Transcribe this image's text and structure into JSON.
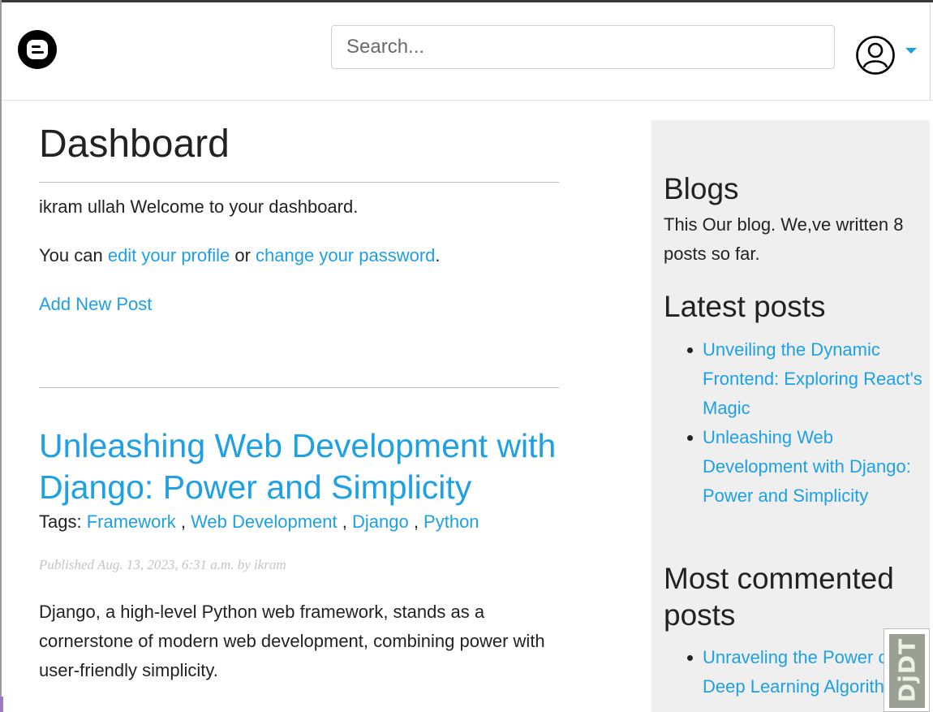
{
  "header": {
    "search_placeholder": "Search...",
    "accent_color": "#1ea0e4"
  },
  "main": {
    "title": "Dashboard",
    "welcome": "ikram ullah Welcome to your dashboard.",
    "profile_prefix": "You can ",
    "edit_profile_link": "edit your profile",
    "or_text": " or ",
    "change_password_link": "change your password",
    "period": ".",
    "add_post_link": "Add New Post",
    "post": {
      "title": "Unleashing Web Development with Django: Power and Simplicity",
      "tags_label": "Tags: ",
      "tags": [
        "Framework",
        "Web Development",
        "Django",
        "Python"
      ],
      "tag_separator": " , ",
      "meta": "Published Aug. 13, 2023, 6:31 a.m. by ikram",
      "excerpt": "Django, a high-level Python web framework, stands as a cornerstone of modern web development, combining power with user-friendly simplicity."
    }
  },
  "sidebar": {
    "blogs_heading": "Blogs",
    "blogs_text": "This Our blog. We,ve written 8 posts so far.",
    "latest_heading": "Latest posts",
    "latest_posts": [
      "Unveiling the Dynamic Frontend: Exploring React's Magic",
      "Unleashing Web Development with Django: Power and Simplicity"
    ],
    "most_commented_heading": "Most commented posts",
    "most_commented_posts": [
      "Unraveling the Power of Deep Learning Algorithms"
    ]
  },
  "debug_toolbar": {
    "label": "DjDT"
  }
}
